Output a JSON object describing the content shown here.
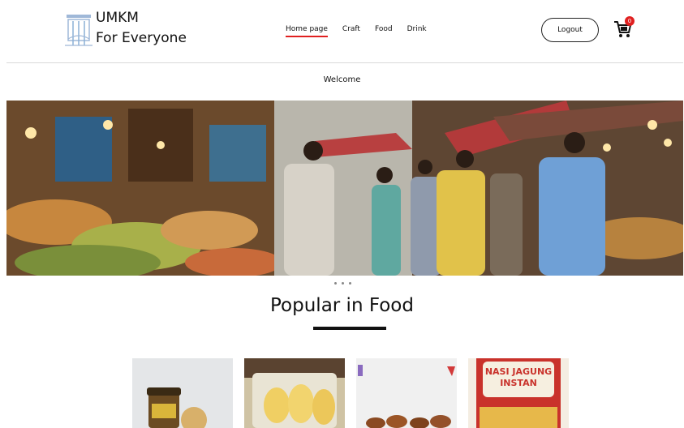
{
  "brand": {
    "line1": "UMKM",
    "line2": "For Everyone"
  },
  "nav": {
    "items": [
      {
        "label": "Home page",
        "active": true
      },
      {
        "label": "Craft",
        "active": false
      },
      {
        "label": "Food",
        "active": false
      },
      {
        "label": "Drink",
        "active": false
      }
    ]
  },
  "header": {
    "logout_label": "Logout",
    "cart_count": "0"
  },
  "welcome": "Welcome",
  "carousel": {
    "slide_count": 3,
    "active_slide": 1
  },
  "section": {
    "title": "Popular in Food"
  },
  "products": [
    {
      "image": "jar-snack-product"
    },
    {
      "image": "packaged-chips-product"
    },
    {
      "image": "fried-snack-product"
    },
    {
      "image": "nasi-jagung-package",
      "text": "NASI JAGUNG INSTAN"
    }
  ],
  "colors": {
    "accent": "#e02020",
    "text": "#111111"
  }
}
